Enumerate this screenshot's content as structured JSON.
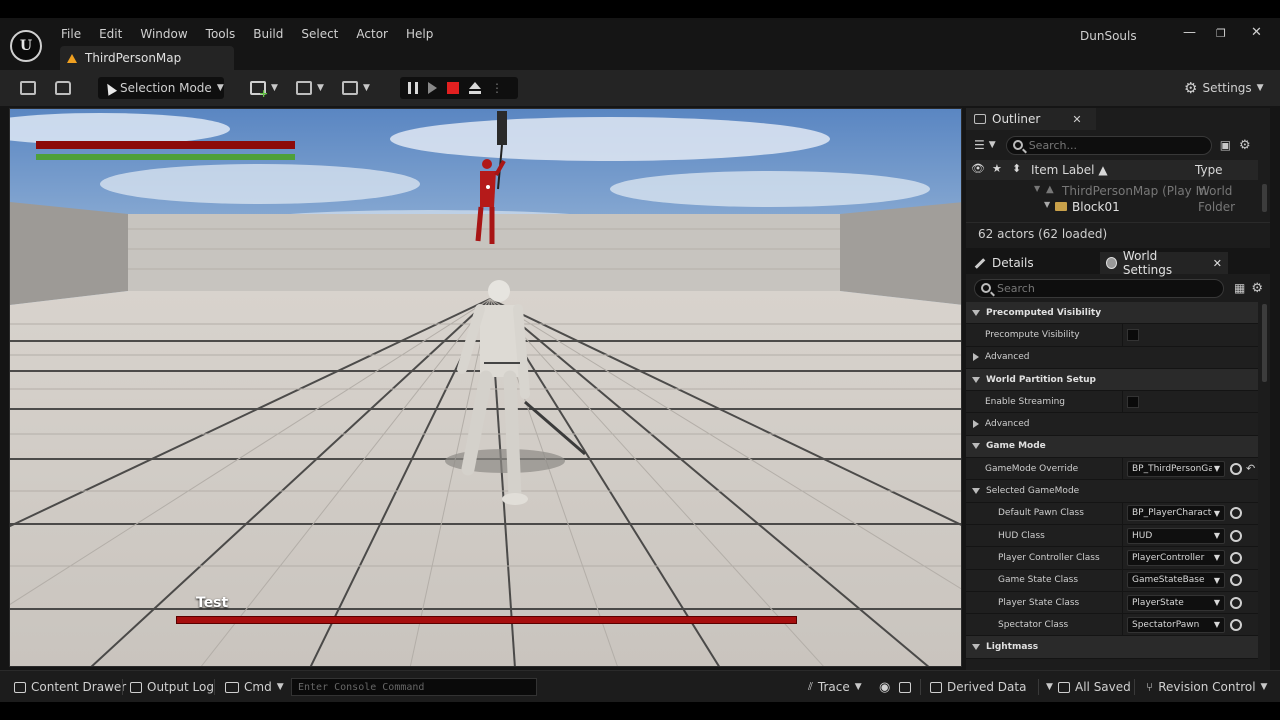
{
  "window": {
    "project_name": "DunSouls",
    "minimize_glyph": "—",
    "restore_glyph": "❐",
    "close_glyph": "✕"
  },
  "menu": [
    "File",
    "Edit",
    "Window",
    "Tools",
    "Build",
    "Select",
    "Actor",
    "Help"
  ],
  "map_tab": {
    "label": "ThirdPersonMap"
  },
  "toolbar": {
    "selection_mode": "Selection Mode",
    "settings": "Settings"
  },
  "viewport": {
    "player_health_pct": 100,
    "player_stamina_pct": 100,
    "boss_name": "Test",
    "boss_health_pct": 100
  },
  "outliner": {
    "tab_label": "Outliner",
    "search_placeholder": "Search...",
    "col_item_label": "Item Label ▲",
    "col_type": "Type",
    "rows": [
      {
        "label": "ThirdPersonMap (Play In",
        "type": "World"
      },
      {
        "label": "Block01",
        "type": "Folder"
      }
    ],
    "actor_count": "62 actors (62 loaded)"
  },
  "details": {
    "tab_details": "Details",
    "tab_world_settings": "World Settings",
    "search_placeholder": "Search",
    "sections": {
      "precomputed_visibility": "Precomputed Visibility",
      "precompute_visibility": "Precompute Visibility",
      "advanced_1": "Advanced",
      "world_partition_setup": "World Partition Setup",
      "enable_streaming": "Enable Streaming",
      "advanced_2": "Advanced",
      "game_mode": "Game Mode",
      "gamemode_override": "GameMode Override",
      "gamemode_override_value": "BP_ThirdPersonGai",
      "selected_gamemode": "Selected GameMode",
      "default_pawn_class": "Default Pawn Class",
      "default_pawn_class_value": "BP_PlayerCharacte",
      "hud_class": "HUD Class",
      "hud_class_value": "HUD",
      "player_controller_class": "Player Controller Class",
      "player_controller_class_value": "PlayerController",
      "game_state_class": "Game State Class",
      "game_state_class_value": "GameStateBase",
      "player_state_class": "Player State Class",
      "player_state_class_value": "PlayerState",
      "spectator_class": "Spectator Class",
      "spectator_class_value": "SpectatorPawn",
      "lightmass": "Lightmass"
    }
  },
  "statusbar": {
    "content_drawer": "Content Drawer",
    "output_log": "Output Log",
    "cmd": "Cmd",
    "console_placeholder": "Enter Console Command",
    "trace": "Trace",
    "derived_data": "Derived Data",
    "all_saved": "All Saved",
    "revision_control": "Revision Control"
  }
}
